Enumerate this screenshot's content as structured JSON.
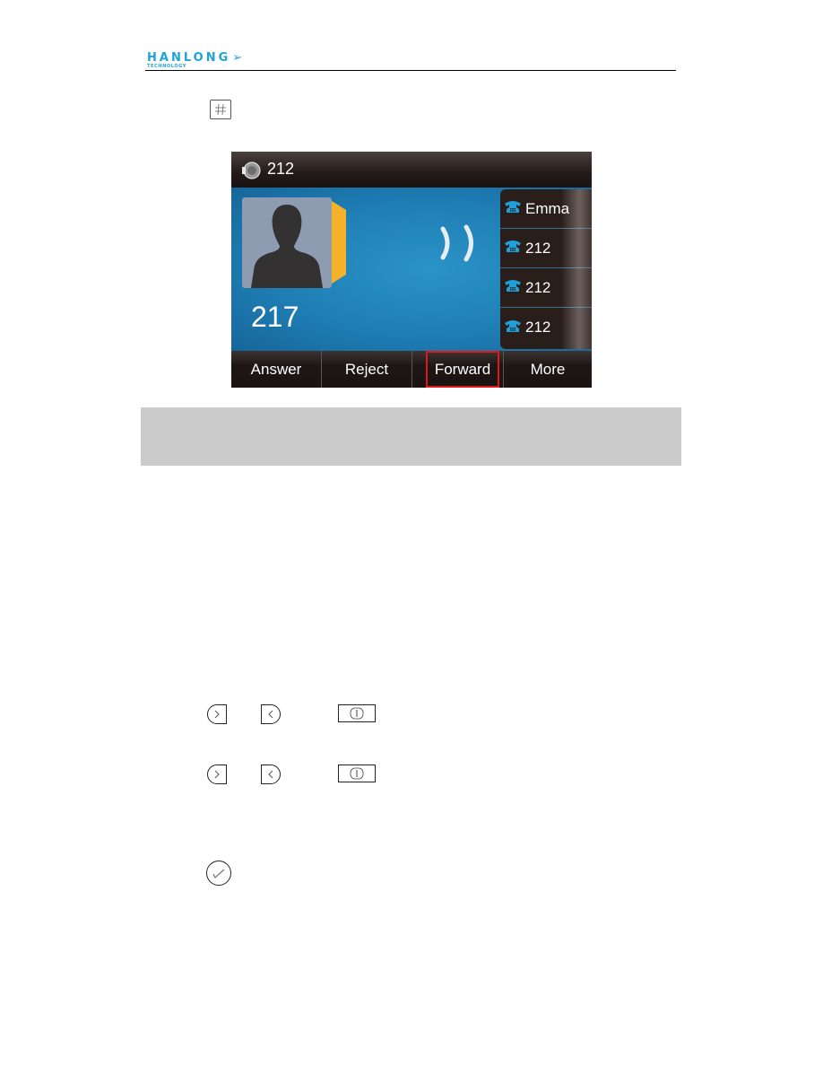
{
  "header": {
    "brand_name": "HANLONG",
    "brand_tagline": "TECHNOLOGY",
    "brand_color": "#1ea3dc"
  },
  "keys": {
    "hash_key_icon": "hash-key",
    "right_key_icon": "navigation-right-key",
    "left_key_icon": "navigation-left-key",
    "ok_key_icon": "ok-key",
    "check_key_icon": "confirm-check-key"
  },
  "phone_screen": {
    "title": "212",
    "caller_number": "217",
    "lines": [
      {
        "label": "Emma"
      },
      {
        "label": "212"
      },
      {
        "label": "212"
      },
      {
        "label": "212"
      }
    ],
    "softkeys": [
      {
        "label": "Answer"
      },
      {
        "label": "Reject"
      },
      {
        "label": "Forward",
        "selected": true
      },
      {
        "label": "More"
      }
    ],
    "colors": {
      "background_blue": "#1f7fb5",
      "accent_yellow": "#f4b12a",
      "line_icon_blue": "#1fa0d8",
      "highlight_red": "#e01818"
    }
  }
}
